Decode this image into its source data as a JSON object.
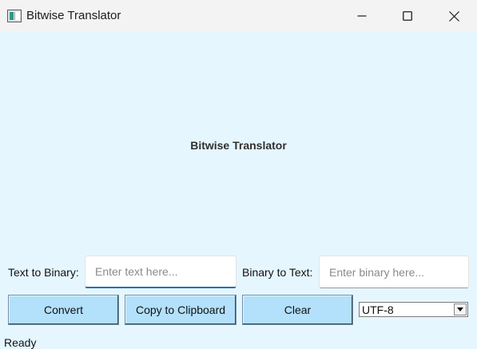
{
  "window": {
    "title": "Bitwise Translator",
    "controls": {
      "minimize_icon": "minimize-icon",
      "maximize_icon": "maximize-icon",
      "close_icon": "close-icon"
    }
  },
  "main": {
    "heading": "Bitwise Translator",
    "text_to_binary": {
      "label": "Text to Binary:",
      "placeholder": "Enter text here...",
      "value": ""
    },
    "binary_to_text": {
      "label": "Binary to Text:",
      "placeholder": "Enter binary here...",
      "value": ""
    }
  },
  "buttons": {
    "convert": "Convert",
    "copy": "Copy to Clipboard",
    "clear": "Clear"
  },
  "encoding": {
    "selected": "UTF-8",
    "arrow_icon": "chevron-down-icon"
  },
  "status": {
    "text": "Ready"
  },
  "colors": {
    "background": "#e6f6ff",
    "titlebar": "#f3f3f3",
    "button": "#b3e0fb",
    "focus_accent": "#1f6fb7"
  }
}
